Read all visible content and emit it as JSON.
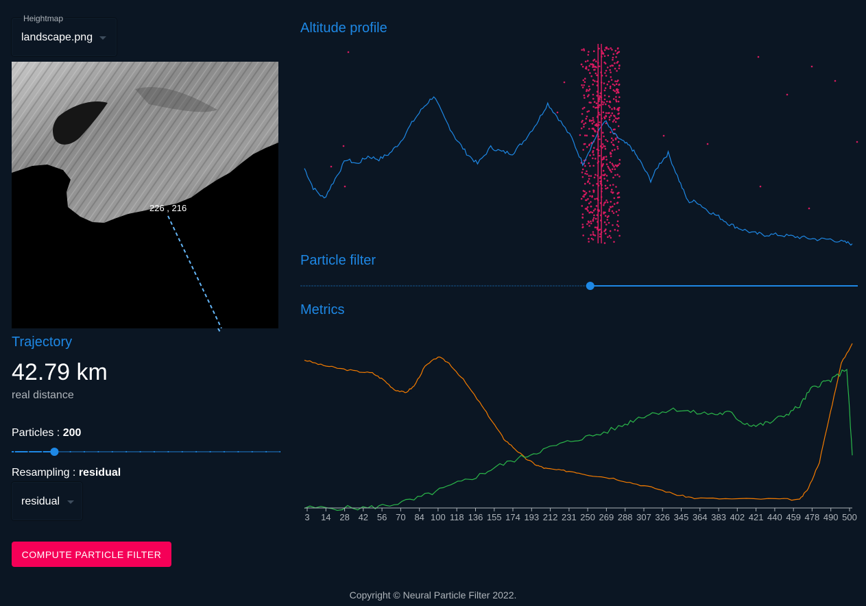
{
  "sidebar": {
    "heightmap_label": "Heightmap",
    "heightmap_value": "landscape.png",
    "map_point_label": "226 , 216",
    "trajectory_title": "Trajectory",
    "distance_value": "42.79 km",
    "distance_caption": "real distance",
    "particles_label": "Particles : ",
    "particles_value": "200",
    "resampling_label": "Resampling : ",
    "resampling_value": "residual",
    "resampling_select_value": "residual",
    "compute_button": "COMPUTE PARTICLE FILTER"
  },
  "main": {
    "altitude_title": "Altitude profile",
    "particle_title": "Particle filter",
    "metrics_title": "Metrics",
    "filter_progress": 0.52,
    "particles_slider_fraction": 0.16
  },
  "colors": {
    "accent": "#1e88e5",
    "particle": "#d81b60",
    "button": "#f50057",
    "series_orange": "#f57c00",
    "series_green": "#2bb84a",
    "background": "#0b1623"
  },
  "footer": {
    "copyright": "Copyright © Neural Particle Filter 2022."
  },
  "chart_data": [
    {
      "type": "line",
      "title": "Altitude profile",
      "x_range": [
        0,
        500
      ],
      "series": [
        {
          "points": [
            [
              0,
              0.52
            ],
            [
              8,
              0.39
            ],
            [
              18,
              0.32
            ],
            [
              28,
              0.45
            ],
            [
              38,
              0.58
            ],
            [
              48,
              0.55
            ],
            [
              58,
              0.6
            ],
            [
              68,
              0.58
            ],
            [
              78,
              0.62
            ],
            [
              88,
              0.7
            ],
            [
              98,
              0.82
            ],
            [
              108,
              0.92
            ],
            [
              118,
              1.0
            ],
            [
              128,
              0.85
            ],
            [
              138,
              0.72
            ],
            [
              148,
              0.62
            ],
            [
              158,
              0.55
            ],
            [
              170,
              0.66
            ],
            [
              180,
              0.63
            ],
            [
              190,
              0.62
            ],
            [
              200,
              0.7
            ],
            [
              212,
              0.82
            ],
            [
              222,
              0.95
            ],
            [
              232,
              0.85
            ],
            [
              244,
              0.72
            ],
            [
              254,
              0.55
            ],
            [
              264,
              0.7
            ],
            [
              274,
              0.84
            ],
            [
              282,
              0.75
            ],
            [
              290,
              0.7
            ],
            [
              298,
              0.66
            ],
            [
              306,
              0.57
            ],
            [
              316,
              0.44
            ],
            [
              324,
              0.55
            ],
            [
              332,
              0.62
            ],
            [
              342,
              0.44
            ],
            [
              350,
              0.3
            ],
            [
              358,
              0.3
            ],
            [
              368,
              0.24
            ],
            [
              378,
              0.2
            ],
            [
              388,
              0.15
            ],
            [
              398,
              0.12
            ],
            [
              410,
              0.09
            ],
            [
              420,
              0.08
            ],
            [
              432,
              0.08
            ],
            [
              444,
              0.07
            ],
            [
              456,
              0.06
            ],
            [
              468,
              0.05
            ],
            [
              480,
              0.05
            ],
            [
              492,
              0.03
            ],
            [
              500,
              0.02
            ]
          ]
        }
      ]
    },
    {
      "type": "line",
      "title": "Metrics",
      "x_range": [
        0,
        500
      ],
      "x_ticks": [
        "3",
        "14",
        "28",
        "42",
        "56",
        "70",
        "84",
        "100",
        "118",
        "136",
        "155",
        "174",
        "193",
        "212",
        "231",
        "250",
        "269",
        "288",
        "307",
        "326",
        "345",
        "364",
        "383",
        "402",
        "421",
        "440",
        "459",
        "478",
        "490",
        "500"
      ],
      "series": [
        {
          "color": "orange",
          "points": [
            [
              0,
              0.9
            ],
            [
              15,
              0.87
            ],
            [
              30,
              0.85
            ],
            [
              48,
              0.83
            ],
            [
              62,
              0.82
            ],
            [
              72,
              0.78
            ],
            [
              82,
              0.72
            ],
            [
              92,
              0.7
            ],
            [
              100,
              0.74
            ],
            [
              110,
              0.86
            ],
            [
              122,
              0.92
            ],
            [
              132,
              0.88
            ],
            [
              145,
              0.78
            ],
            [
              160,
              0.64
            ],
            [
              172,
              0.52
            ],
            [
              182,
              0.42
            ],
            [
              192,
              0.36
            ],
            [
              202,
              0.3
            ],
            [
              212,
              0.26
            ],
            [
              220,
              0.24
            ],
            [
              232,
              0.23
            ],
            [
              246,
              0.22
            ],
            [
              260,
              0.2
            ],
            [
              282,
              0.18
            ],
            [
              300,
              0.15
            ],
            [
              320,
              0.12
            ],
            [
              340,
              0.08
            ],
            [
              356,
              0.06
            ],
            [
              390,
              0.055
            ],
            [
              430,
              0.055
            ],
            [
              452,
              0.05
            ],
            [
              460,
              0.12
            ],
            [
              470,
              0.28
            ],
            [
              480,
              0.58
            ],
            [
              490,
              0.88
            ],
            [
              500,
              1.0
            ]
          ]
        },
        {
          "color": "green",
          "points": [
            [
              0,
              0.0
            ],
            [
              30,
              0.0
            ],
            [
              58,
              0.0
            ],
            [
              78,
              0.02
            ],
            [
              100,
              0.05
            ],
            [
              120,
              0.1
            ],
            [
              140,
              0.15
            ],
            [
              160,
              0.2
            ],
            [
              175,
              0.25
            ],
            [
              195,
              0.3
            ],
            [
              212,
              0.34
            ],
            [
              230,
              0.38
            ],
            [
              250,
              0.42
            ],
            [
              270,
              0.45
            ],
            [
              290,
              0.5
            ],
            [
              305,
              0.55
            ],
            [
              320,
              0.58
            ],
            [
              340,
              0.6
            ],
            [
              355,
              0.58
            ],
            [
              375,
              0.57
            ],
            [
              388,
              0.58
            ],
            [
              400,
              0.52
            ],
            [
              412,
              0.5
            ],
            [
              425,
              0.52
            ],
            [
              440,
              0.57
            ],
            [
              452,
              0.62
            ],
            [
              462,
              0.72
            ],
            [
              472,
              0.76
            ],
            [
              482,
              0.78
            ],
            [
              495,
              0.85
            ],
            [
              500,
              0.32
            ]
          ]
        }
      ]
    }
  ]
}
